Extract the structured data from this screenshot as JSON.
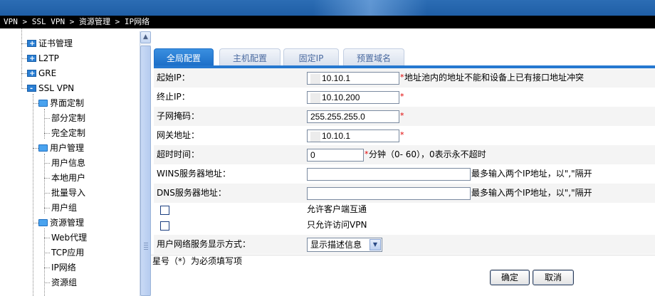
{
  "breadcrumb": "VPN > SSL VPN > 资源管理 > IP网络",
  "sidebar": {
    "items": [
      {
        "label": "证书管理",
        "icon": "collapsed-node-icon"
      },
      {
        "label": "L2TP",
        "icon": "collapsed-node-icon"
      },
      {
        "label": "GRE",
        "icon": "collapsed-node-icon"
      },
      {
        "label": "SSL VPN",
        "icon": "expanded-node-icon"
      },
      {
        "label": "界面定制",
        "icon": "folder-icon"
      },
      {
        "label": "部分定制"
      },
      {
        "label": "完全定制"
      },
      {
        "label": "用户管理",
        "icon": "folder-icon"
      },
      {
        "label": "用户信息"
      },
      {
        "label": "本地用户"
      },
      {
        "label": "批量导入"
      },
      {
        "label": "用户组"
      },
      {
        "label": "资源管理",
        "icon": "folder-icon"
      },
      {
        "label": "Web代理"
      },
      {
        "label": "TCP应用"
      },
      {
        "label": "IP网络"
      },
      {
        "label": "资源组"
      },
      {
        "label": "..."
      }
    ]
  },
  "tabs": [
    {
      "label": "全局配置",
      "active": true
    },
    {
      "label": "主机配置",
      "active": false
    },
    {
      "label": "固定IP",
      "active": false
    },
    {
      "label": "预置域名",
      "active": false
    }
  ],
  "form": {
    "start_ip": {
      "label": "起始IP：",
      "value": "10.10.1",
      "note": "地址池内的地址不能和设备上已有接口地址冲突"
    },
    "end_ip": {
      "label": "终止IP：",
      "value": "10.10.200"
    },
    "subnet_mask": {
      "label": "子网掩码：",
      "value": "255.255.255.0"
    },
    "gateway": {
      "label": "网关地址：",
      "value": "10.10.1"
    },
    "timeout": {
      "label": "超时时间：",
      "value": "0",
      "note": "分钟（0- 60），0表示永不超时"
    },
    "wins": {
      "label": "WINS服务器地址：",
      "value": "",
      "note": "最多输入两个IP地址，以\",\"隔开"
    },
    "dns": {
      "label": "DNS服务器地址：",
      "value": "",
      "note": "最多输入两个IP地址，以\",\"隔开"
    },
    "allow_client_interconnect": {
      "label": "允许客户端互通",
      "checked": false
    },
    "vpn_only": {
      "label": "只允许访问VPN",
      "checked": false
    },
    "display_mode": {
      "label": "用户网络服务显示方式：",
      "value": "显示描述信息"
    },
    "required_mark": "*"
  },
  "footnote": "星号（*）为必须填写项",
  "buttons": {
    "ok": "确定",
    "cancel": "取消"
  }
}
